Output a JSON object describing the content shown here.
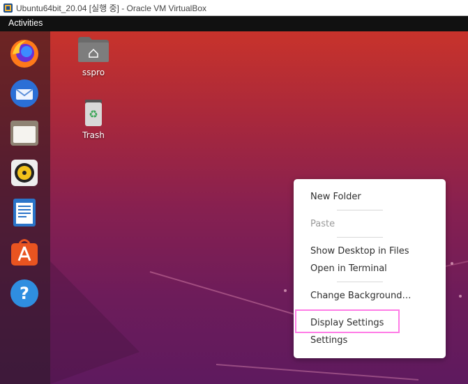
{
  "window": {
    "title": "Ubuntu64bit_20.04 [실행 중] - Oracle VM VirtualBox"
  },
  "topbar": {
    "activities_label": "Activities"
  },
  "dock": {
    "items": [
      {
        "name": "Firefox",
        "icon": "firefox-icon"
      },
      {
        "name": "Thunderbird",
        "icon": "thunderbird-icon"
      },
      {
        "name": "Files",
        "icon": "files-icon"
      },
      {
        "name": "Rhythmbox",
        "icon": "rhythmbox-icon"
      },
      {
        "name": "LibreOffice Writer",
        "icon": "writer-icon"
      },
      {
        "name": "Ubuntu Software",
        "icon": "software-icon"
      },
      {
        "name": "Help",
        "icon": "help-icon"
      }
    ]
  },
  "desktop": {
    "icons": [
      {
        "label": "sspro",
        "icon": "home-folder-icon"
      },
      {
        "label": "Trash",
        "icon": "trash-icon"
      }
    ]
  },
  "context_menu": {
    "items": [
      {
        "label": "New Folder",
        "enabled": true
      },
      {
        "label": "Paste",
        "enabled": false
      },
      {
        "label": "Show Desktop in Files",
        "enabled": true
      },
      {
        "label": "Open in Terminal",
        "enabled": true
      },
      {
        "label": "Change Background…",
        "enabled": true
      },
      {
        "label": "Display Settings",
        "enabled": true,
        "highlighted": true
      },
      {
        "label": "Settings",
        "enabled": true
      }
    ]
  },
  "colors": {
    "highlight": "#ff7ce6",
    "topbar": "#111111",
    "menu_bg": "#ffffff"
  }
}
